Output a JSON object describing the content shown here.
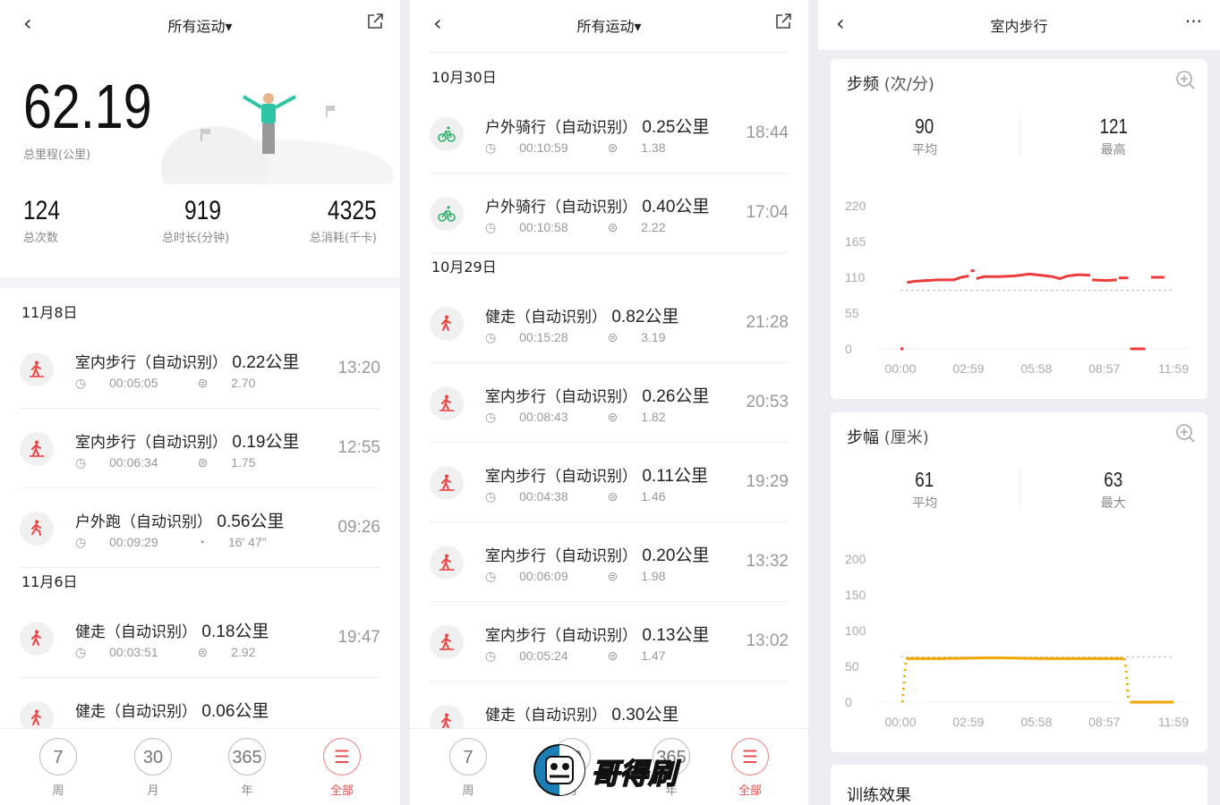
{
  "colors": {
    "accent": "#e85050",
    "cadence": "#ee3b3b",
    "stride": "#f0a500",
    "bike": "#2db36b",
    "walk": "#ee4444"
  },
  "panel1": {
    "title": "所有运动▾",
    "total_distance": "62.19",
    "total_distance_label": "总里程(公里)",
    "stats": [
      {
        "value": "124",
        "label": "总次数"
      },
      {
        "value": "919",
        "label": "总时长(分钟)"
      },
      {
        "value": "4325",
        "label": "总消耗(千卡)"
      }
    ],
    "groups": [
      {
        "date": "11月8日",
        "items": [
          {
            "icon": "indoor-walk-icon",
            "name": "室内步行（自动识别）",
            "dist": "0.22公里",
            "duration": "00:05:05",
            "metric_icon": "speed-icon",
            "metric": "2.70",
            "time": "13:20"
          },
          {
            "icon": "indoor-walk-icon",
            "name": "室内步行（自动识别）",
            "dist": "0.19公里",
            "duration": "00:06:34",
            "metric_icon": "speed-icon",
            "metric": "1.75",
            "time": "12:55"
          },
          {
            "icon": "run-icon",
            "name": "户外跑（自动识别）",
            "dist": "0.56公里",
            "duration": "00:09:29",
            "metric_icon": "pace-icon",
            "metric": "16' 47\"",
            "time": "09:26"
          }
        ]
      },
      {
        "date": "11月6日",
        "items": [
          {
            "icon": "walk-icon",
            "name": "健走（自动识别）",
            "dist": "0.18公里",
            "duration": "00:03:51",
            "metric_icon": "speed-icon",
            "metric": "2.92",
            "time": "19:47"
          },
          {
            "icon": "walk-icon",
            "name": "健走（自动识别）",
            "dist": "0.06公里",
            "duration": "",
            "metric_icon": "",
            "metric": "",
            "time": ""
          }
        ]
      }
    ]
  },
  "panel2": {
    "title": "所有运动▾",
    "groups": [
      {
        "date": "10月30日",
        "items": [
          {
            "icon": "bike-icon",
            "name": "户外骑行（自动识别）",
            "dist": "0.25公里",
            "duration": "00:10:59",
            "metric_icon": "speed-icon",
            "metric": "1.38",
            "time": "18:44"
          },
          {
            "icon": "bike-icon",
            "name": "户外骑行（自动识别）",
            "dist": "0.40公里",
            "duration": "00:10:58",
            "metric_icon": "speed-icon",
            "metric": "2.22",
            "time": "17:04"
          }
        ]
      },
      {
        "date": "10月29日",
        "items": [
          {
            "icon": "walk-icon",
            "name": "健走（自动识别）",
            "dist": "0.82公里",
            "duration": "00:15:28",
            "metric_icon": "speed-icon",
            "metric": "3.19",
            "time": "21:28"
          },
          {
            "icon": "indoor-walk-icon",
            "name": "室内步行（自动识别）",
            "dist": "0.26公里",
            "duration": "00:08:43",
            "metric_icon": "speed-icon",
            "metric": "1.82",
            "time": "20:53"
          },
          {
            "icon": "indoor-walk-icon",
            "name": "室内步行（自动识别）",
            "dist": "0.11公里",
            "duration": "00:04:38",
            "metric_icon": "speed-icon",
            "metric": "1.46",
            "time": "19:29"
          },
          {
            "icon": "indoor-walk-icon",
            "name": "室内步行（自动识别）",
            "dist": "0.20公里",
            "duration": "00:06:09",
            "metric_icon": "speed-icon",
            "metric": "1.98",
            "time": "13:32"
          },
          {
            "icon": "indoor-walk-icon",
            "name": "室内步行（自动识别）",
            "dist": "0.13公里",
            "duration": "00:05:24",
            "metric_icon": "speed-icon",
            "metric": "1.47",
            "time": "13:02"
          },
          {
            "icon": "walk-icon",
            "name": "健走（自动识别）",
            "dist": "0.30公里",
            "duration": "",
            "metric_icon": "",
            "metric": "",
            "time": ""
          }
        ]
      }
    ]
  },
  "nav": [
    {
      "num": "7",
      "label": "周"
    },
    {
      "num": "30",
      "label": "月"
    },
    {
      "num": "365",
      "label": "年"
    },
    {
      "num": "☰",
      "label": "全部",
      "active": true
    }
  ],
  "panel3": {
    "title": "室内步行",
    "more": "···",
    "cadence": {
      "title": "步频",
      "unit": "(次/分)",
      "avg": "90",
      "avg_label": "平均",
      "max": "121",
      "max_label": "最高"
    },
    "stride": {
      "title": "步幅",
      "unit": "(厘米)",
      "avg": "61",
      "avg_label": "平均",
      "max": "63",
      "max_label": "最大"
    },
    "training": {
      "title": "训练效果"
    }
  },
  "chart_data": [
    {
      "type": "scatter",
      "series_color": "#ee3b3b",
      "ylim": [
        0,
        220
      ],
      "yticks": [
        "0",
        "55",
        "110",
        "165",
        "220"
      ],
      "xticks": [
        "00:00",
        "02:59",
        "05:58",
        "08:57",
        "11:59"
      ],
      "xlim": [
        "00:00",
        "11:59"
      ],
      "reference_line": 90,
      "grid": false,
      "segments": [
        [
          [
            "00:00",
            0
          ],
          [
            "00:08",
            0
          ]
        ],
        [
          [
            "00:17",
            102
          ],
          [
            "00:40",
            104
          ],
          [
            "01:10",
            105
          ],
          [
            "01:40",
            106
          ],
          [
            "02:20",
            106
          ],
          [
            "02:40",
            110
          ],
          [
            "03:00",
            112
          ]
        ],
        [
          [
            "03:05",
            120
          ],
          [
            "03:15",
            120
          ]
        ],
        [
          [
            "03:20",
            108
          ],
          [
            "03:40",
            111
          ],
          [
            "04:20",
            111
          ],
          [
            "05:00",
            112
          ],
          [
            "05:40",
            115
          ],
          [
            "06:10",
            113
          ],
          [
            "06:40",
            111
          ],
          [
            "07:00",
            108
          ],
          [
            "07:20",
            112
          ],
          [
            "07:50",
            114
          ],
          [
            "08:20",
            113
          ]
        ],
        [
          [
            "08:25",
            106
          ],
          [
            "09:00",
            105
          ],
          [
            "09:30",
            106
          ]
        ],
        [
          [
            "09:35",
            109
          ],
          [
            "10:00",
            109
          ]
        ],
        [
          [
            "10:05",
            0
          ],
          [
            "10:45",
            0
          ]
        ],
        [
          [
            "11:00",
            110
          ],
          [
            "11:35",
            110
          ]
        ]
      ]
    },
    {
      "type": "scatter",
      "series_color": "#f0a500",
      "ylim": [
        0,
        200
      ],
      "yticks": [
        "0",
        "50",
        "100",
        "150",
        "200"
      ],
      "xticks": [
        "00:00",
        "02:59",
        "05:58",
        "08:57",
        "11:59"
      ],
      "xlim": [
        "00:00",
        "11:59"
      ],
      "reference_line": 63,
      "grid": false,
      "segments": [
        [
          [
            "00:05",
            0
          ],
          [
            "00:10",
            30
          ],
          [
            "00:15",
            61
          ]
        ],
        [
          [
            "00:15",
            61
          ],
          [
            "02:00",
            61
          ],
          [
            "04:00",
            62
          ],
          [
            "06:00",
            61
          ],
          [
            "08:00",
            61
          ],
          [
            "09:48",
            61
          ]
        ],
        [
          [
            "09:50",
            61
          ],
          [
            "09:55",
            40
          ],
          [
            "10:00",
            5
          ]
        ],
        [
          [
            "10:05",
            0
          ],
          [
            "11:59",
            0
          ]
        ]
      ]
    }
  ],
  "watermark": {
    "text": "哥得刷"
  }
}
